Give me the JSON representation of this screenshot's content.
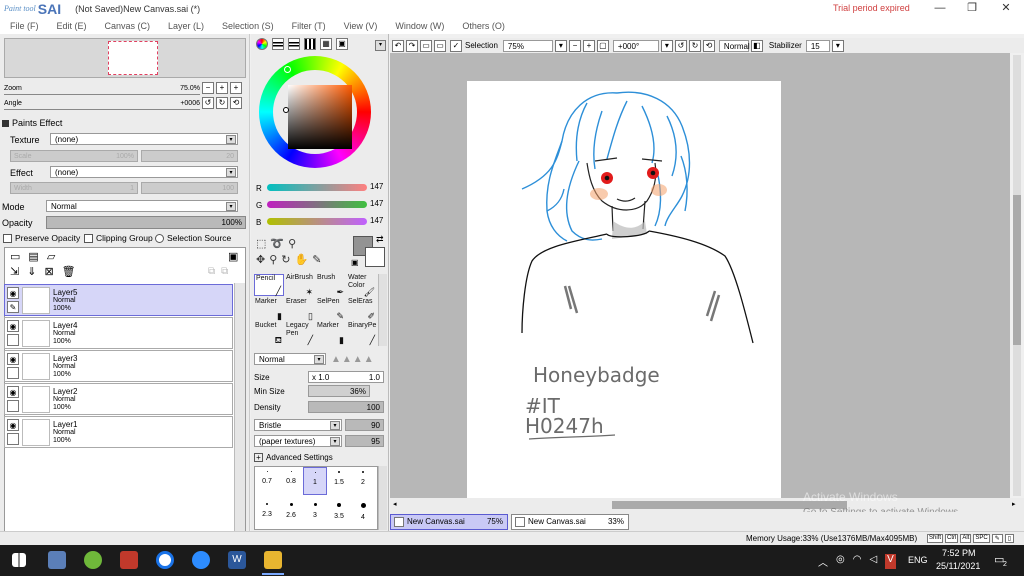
{
  "titlebar": {
    "logo_small": "Paint tool",
    "logo_big": "SAI",
    "document": "(Not Saved)New Canvas.sai (*)",
    "trial": "Trial period expired",
    "minimize": "—",
    "restore": "❐",
    "close": "✕"
  },
  "menu": [
    "File (F)",
    "Edit (E)",
    "Canvas (C)",
    "Layer (L)",
    "Selection (S)",
    "Filter (T)",
    "View (V)",
    "Window (W)",
    "Others (O)"
  ],
  "navigator": {
    "zoom_label": "Zoom",
    "zoom_value": "75.0%",
    "angle_label": "Angle",
    "angle_value": "+0006"
  },
  "paints_effect": {
    "header": "Paints Effect",
    "texture_label": "Texture",
    "texture_value": "(none)",
    "scale_label": "Scale",
    "scale_value": "100%",
    "scale_right": "20",
    "effect_label": "Effect",
    "effect_value": "(none)",
    "width_label": "Width",
    "width_value": "1",
    "width_right": "100"
  },
  "layer_props": {
    "mode_label": "Mode",
    "mode_value": "Normal",
    "opacity_label": "Opacity",
    "opacity_value": "100%",
    "preserve_opacity": "Preserve Opacity",
    "clipping_group": "Clipping Group",
    "selection_source": "Selection Source"
  },
  "layers": [
    {
      "name": "Layer5",
      "mode": "Normal",
      "opacity": "100%",
      "selected": true
    },
    {
      "name": "Layer4",
      "mode": "Normal",
      "opacity": "100%",
      "selected": false
    },
    {
      "name": "Layer3",
      "mode": "Normal",
      "opacity": "100%",
      "selected": false
    },
    {
      "name": "Layer2",
      "mode": "Normal",
      "opacity": "100%",
      "selected": false
    },
    {
      "name": "Layer1",
      "mode": "Normal",
      "opacity": "100%",
      "selected": false
    }
  ],
  "color": {
    "r_label": "R",
    "r_value": "147",
    "g_label": "G",
    "g_value": "147",
    "b_label": "B",
    "b_value": "147",
    "current": "#939393"
  },
  "tools": [
    {
      "label": "Pencil"
    },
    {
      "label": "AirBrush"
    },
    {
      "label": "Brush"
    },
    {
      "label": "Water Color"
    },
    {
      "label": "Marker"
    },
    {
      "label": "Eraser"
    },
    {
      "label": "SelPen"
    },
    {
      "label": "SelEras"
    },
    {
      "label": "Bucket"
    },
    {
      "label": "Legacy Pen"
    },
    {
      "label": "Marker"
    },
    {
      "label": "BinaryPe"
    }
  ],
  "brush": {
    "mode_value": "Normal",
    "size_label": "Size",
    "size_mult": "x 1.0",
    "size_value": "1.0",
    "minsize_label": "Min Size",
    "minsize_value": "36%",
    "density_label": "Density",
    "density_value": "100",
    "bristle_label": "Bristle",
    "bristle_value": "90",
    "texture_label": "(paper textures)",
    "texture_value": "95",
    "advanced": "Advanced Settings",
    "sizes_row1": [
      "0.7",
      "0.8",
      "1",
      "1.5",
      "2"
    ],
    "sizes_row2": [
      "2.3",
      "2.6",
      "3",
      "3.5",
      "4"
    ]
  },
  "toolbar": {
    "selection_label": "Selection",
    "zoom_value": "75%",
    "angle_value": "+000°",
    "blend_value": "Normal",
    "stabilizer_label": "Stabilizer",
    "stabilizer_value": "15"
  },
  "drawing": {
    "line1": "Honeybadge",
    "line2": "#IT",
    "line3": "H0247h"
  },
  "tabs": [
    {
      "name": "New Canvas.sai",
      "zoom": "75%"
    },
    {
      "name": "New Canvas.sai",
      "zoom": "33%"
    }
  ],
  "watermark": {
    "line1": "Activate Windows",
    "line2": "Go to Settings to activate Windows."
  },
  "status": {
    "memory": "Memory Usage:33% (Use1376MB/Max4095MB)",
    "keys": [
      "Shift",
      "Ctrl",
      "Alt",
      "SPC"
    ]
  },
  "taskbar": {
    "lang": "ENG",
    "time": "7:52 PM",
    "date": "25/11/2021",
    "notif_count": "2"
  }
}
